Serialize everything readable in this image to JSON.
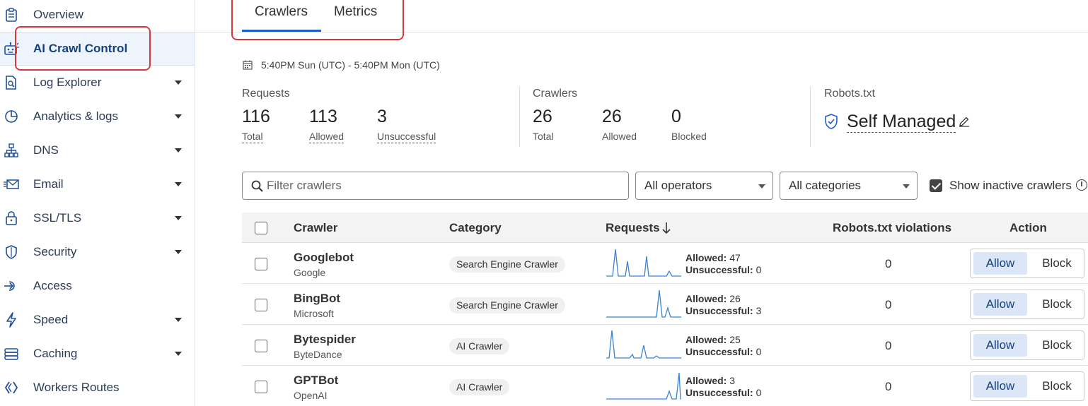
{
  "sidebar": {
    "items": [
      {
        "label": "Overview",
        "icon": "clipboard-icon",
        "caret": false
      },
      {
        "label": "AI Crawl Control",
        "icon": "robot-icon",
        "caret": false,
        "active": true
      },
      {
        "label": "Log Explorer",
        "icon": "document-search-icon",
        "caret": true
      },
      {
        "label": "Analytics & logs",
        "icon": "pie-chart-icon",
        "caret": true
      },
      {
        "label": "DNS",
        "icon": "network-icon",
        "caret": true
      },
      {
        "label": "Email",
        "icon": "email-icon",
        "caret": true
      },
      {
        "label": "SSL/TLS",
        "icon": "lock-icon",
        "caret": true
      },
      {
        "label": "Security",
        "icon": "shield-icon",
        "caret": true
      },
      {
        "label": "Access",
        "icon": "access-icon",
        "caret": false
      },
      {
        "label": "Speed",
        "icon": "lightning-icon",
        "caret": true
      },
      {
        "label": "Caching",
        "icon": "database-icon",
        "caret": true
      },
      {
        "label": "Workers Routes",
        "icon": "workers-icon",
        "caret": false
      }
    ]
  },
  "tabs": [
    {
      "label": "Crawlers",
      "active": true
    },
    {
      "label": "Metrics",
      "active": false
    }
  ],
  "date_range": "5:40PM Sun (UTC) - 5:40PM Mon (UTC)",
  "stats": {
    "requests": {
      "heading": "Requests",
      "items": [
        {
          "value": "116",
          "label": "Total"
        },
        {
          "value": "113",
          "label": "Allowed"
        },
        {
          "value": "3",
          "label": "Unsuccessful"
        }
      ]
    },
    "crawlers": {
      "heading": "Crawlers",
      "items": [
        {
          "value": "26",
          "label": "Total"
        },
        {
          "value": "26",
          "label": "Allowed"
        },
        {
          "value": "0",
          "label": "Blocked"
        }
      ]
    },
    "robots": {
      "heading": "Robots.txt",
      "value": "Self Managed"
    }
  },
  "filters": {
    "search_placeholder": "Filter crawlers",
    "operators": "All operators",
    "categories": "All categories",
    "show_inactive": "Show inactive crawlers",
    "show_inactive_checked": true
  },
  "table": {
    "headers": {
      "crawler": "Crawler",
      "category": "Category",
      "requests": "Requests",
      "violations": "Robots.txt violations",
      "action": "Action"
    },
    "allowed_label": "Allowed:",
    "unsuccessful_label": "Unsuccessful:",
    "allow_label": "Allow",
    "block_label": "Block",
    "rows": [
      {
        "name": "Googlebot",
        "operator": "Google",
        "category": "Search Engine Crawler",
        "allowed": "47",
        "unsuccessful": "0",
        "violations": "0"
      },
      {
        "name": "BingBot",
        "operator": "Microsoft",
        "category": "Search Engine Crawler",
        "allowed": "26",
        "unsuccessful": "3",
        "violations": "0"
      },
      {
        "name": "Bytespider",
        "operator": "ByteDance",
        "category": "AI Crawler",
        "allowed": "25",
        "unsuccessful": "0",
        "violations": "0"
      },
      {
        "name": "GPTBot",
        "operator": "OpenAI",
        "category": "AI Crawler",
        "allowed": "3",
        "unsuccessful": "0",
        "violations": "0"
      }
    ]
  },
  "colors": {
    "accent": "#1f5fbf",
    "highlight": "#d9363e",
    "spark": "#3b82d6"
  }
}
